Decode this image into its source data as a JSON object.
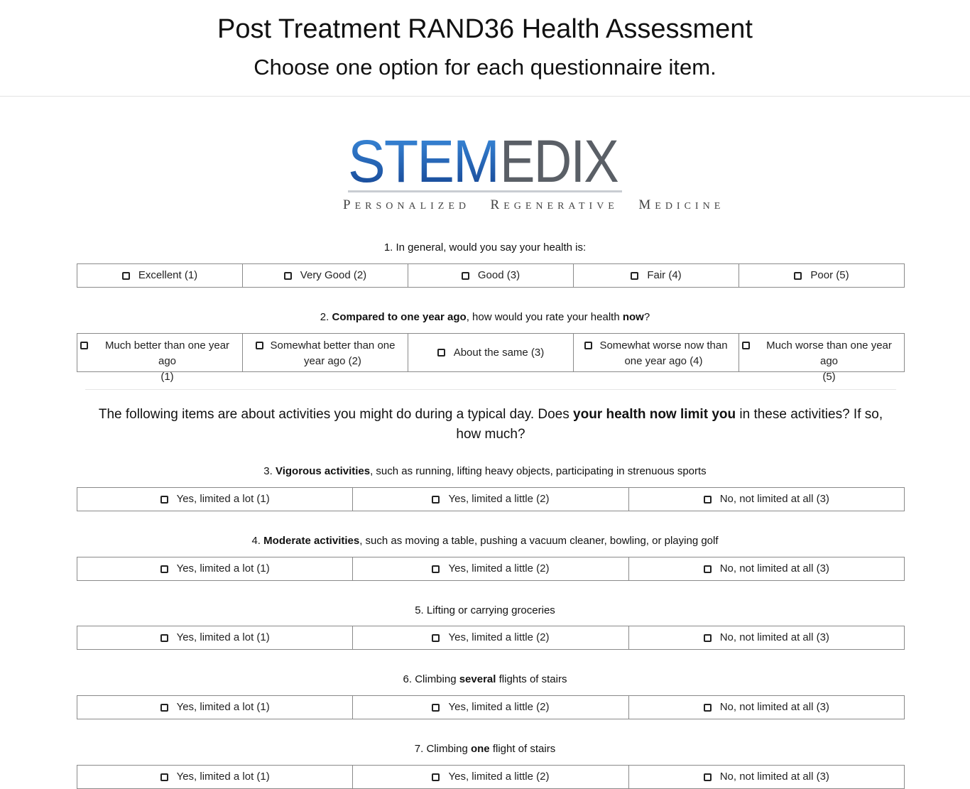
{
  "header": {
    "title": "Post Treatment RAND36 Health Assessment",
    "subtitle": "Choose one option for each questionnaire item."
  },
  "logo": {
    "brand": "STEMEDIX",
    "tagline_words": [
      {
        "cap": "P",
        "rest": "ERSONALIZED"
      },
      {
        "cap": "R",
        "rest": "EGENERATIVE"
      },
      {
        "cap": "M",
        "rest": "EDICINE"
      }
    ],
    "colors": {
      "blue": "#1f5fb4",
      "gray": "#5a5f66"
    }
  },
  "q1": {
    "text": "1. In general, would you say your health is:",
    "options": [
      "Excellent (1)",
      "Very Good (2)",
      "Good (3)",
      "Fair (4)",
      "Poor (5)"
    ]
  },
  "q2": {
    "prefix": "2. ",
    "bold1": "Compared to one year ago",
    "middle": ", how would you rate your health ",
    "bold2": "now",
    "suffix": "?",
    "options": [
      {
        "line1": "Much better than one year ago",
        "line2": "(1)"
      },
      {
        "line1": "Somewhat better than one",
        "line2": "year ago (2)"
      },
      {
        "line1": "About the same (3)",
        "line2": ""
      },
      {
        "line1": "Somewhat worse now than",
        "line2": "one year ago (4)"
      },
      {
        "line1": "Much worse than one year ago",
        "line2": "(5)"
      }
    ]
  },
  "intro": {
    "part1": "The following items are about activities you might do during a typical day. Does ",
    "bold": "your health now limit you",
    "part2": " in these activities? If so, how much?"
  },
  "limit_options": [
    "Yes, limited a lot (1)",
    "Yes, limited a little (2)",
    "No, not limited at all (3)"
  ],
  "q3": {
    "prefix": "3. ",
    "bold": "Vigorous activities",
    "suffix": ", such as running, lifting heavy objects, participating in strenuous sports"
  },
  "q4": {
    "prefix": "4. ",
    "bold": "Moderate activities",
    "suffix": ", such as moving a table, pushing a vacuum cleaner, bowling, or playing golf"
  },
  "q5": {
    "prefix": "5. Lifting or carrying groceries",
    "bold": "",
    "suffix": ""
  },
  "q6": {
    "prefix": "6. Climbing ",
    "bold": "several",
    "suffix": " flights of stairs"
  },
  "q7": {
    "prefix": "7. Climbing ",
    "bold": "one",
    "suffix": " flight of stairs"
  }
}
